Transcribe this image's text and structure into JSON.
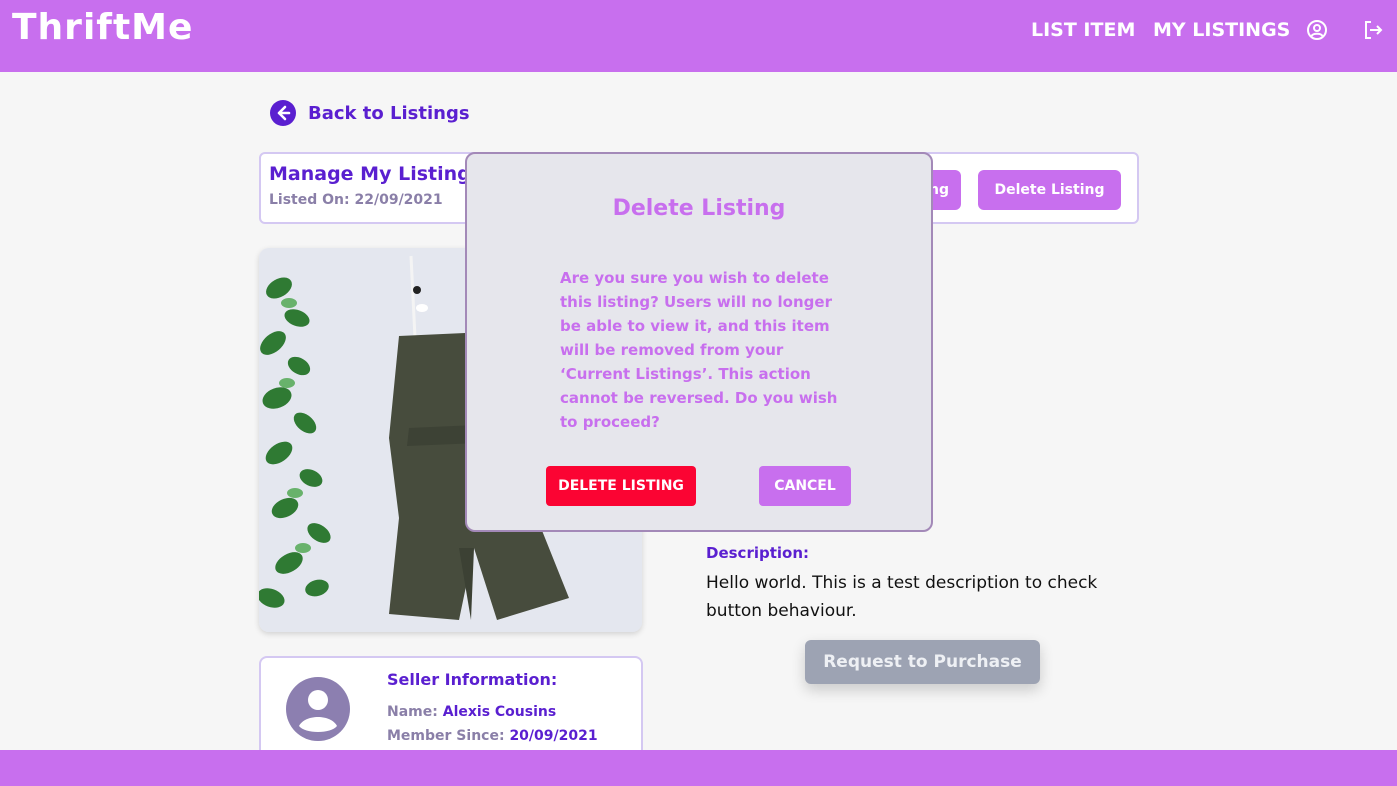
{
  "navbar": {
    "brand": "ThriftMe",
    "links": [
      {
        "label": "LIST ITEM"
      },
      {
        "label": "MY LISTINGS"
      }
    ],
    "icons": [
      "account-icon",
      "logout-icon"
    ]
  },
  "back_link": {
    "label": "Back to Listings",
    "icon": "arrow-left-circle-icon"
  },
  "manage": {
    "title": "Manage My Listing:",
    "listed_on_label": "Listed On:",
    "listed_on_value": "22/09/2021",
    "edit_label_partial": "ng",
    "delete_label": "Delete Listing"
  },
  "seller": {
    "title": "Seller Information:",
    "name_label": "Name:",
    "name_value": "Alexis Cousins",
    "member_label": "Member Since:",
    "member_value": "20/09/2021"
  },
  "description": {
    "label": "Description:",
    "text": "Hello world. This is a test description to check button behaviour."
  },
  "purchase_button": "Request to Purchase",
  "modal": {
    "title": "Delete Listing",
    "body": "Are you sure you wish to delete this listing? Users will no longer be able to view it, and this item will be removed from your ‘Current Listings’. This action cannot be reversed. Do you wish to proceed?",
    "confirm_label": "DELETE LISTING",
    "cancel_label": "CANCEL"
  },
  "colors": {
    "brand": "#c86fee",
    "heading": "#5a1fd0",
    "muted": "#8a7fa8",
    "danger": "#fb0433",
    "disabled": "#9da3b3"
  }
}
